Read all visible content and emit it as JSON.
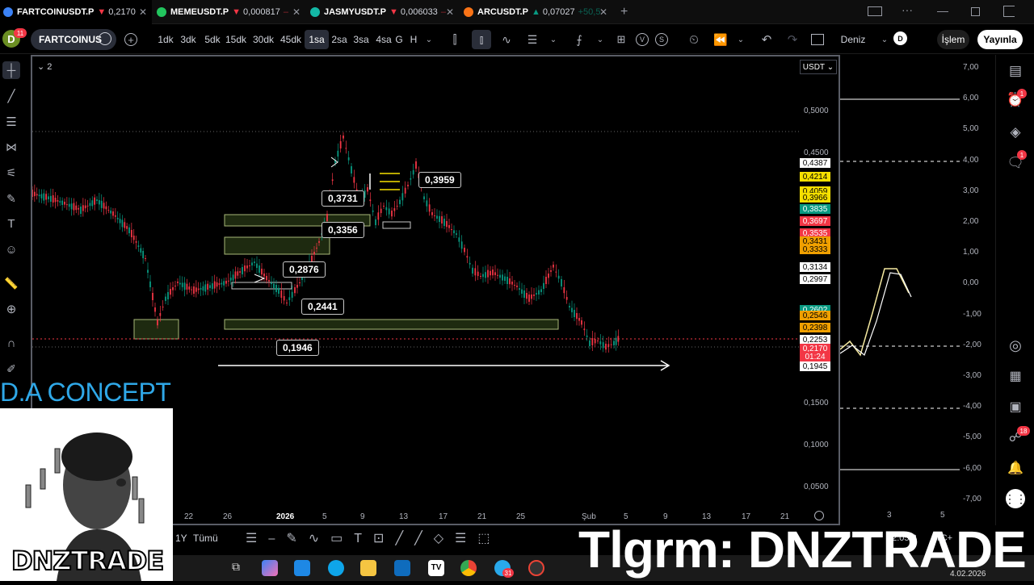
{
  "tabs": [
    {
      "symbol": "FARTCOINUSDT.P",
      "dir": "▼",
      "price": "0,2170",
      "change": "",
      "logo_color": "#3b82f6"
    },
    {
      "symbol": "MEMEUSDT.P",
      "dir": "▼",
      "price": "0,000817",
      "change": "–",
      "logo_color": "#22c55e"
    },
    {
      "symbol": "JASMYUSDT.P",
      "dir": "▼",
      "price": "0,006033",
      "change": "–",
      "logo_color": "#14b8a6"
    },
    {
      "symbol": "ARCUSDT.P",
      "dir": "▲",
      "price": "0,07027",
      "change": "+50,5",
      "logo_color": "#f97316"
    }
  ],
  "toolbar": {
    "avatar": "D",
    "avatar_badge": "11",
    "symbol": "FARTCOINUS",
    "intervals": [
      "1dk",
      "3dk",
      "5dk",
      "15dk",
      "30dk",
      "45dk",
      "1sa",
      "2sa",
      "3sa",
      "4sa",
      "G",
      "H"
    ],
    "active_interval": "1sa",
    "layout_name": "Deniz",
    "layout_badge": "D",
    "trade_label": "İşlem",
    "publish_label": "Yayınla",
    "alert_v": "V",
    "alert_s": "S"
  },
  "chart": {
    "legend_count": "2",
    "currency": "USDT",
    "price_ticks": [
      "0,5000",
      "0,4500",
      "0,1500",
      "0,1000",
      "0,0500"
    ],
    "price_labels": [
      {
        "value": "0,4387",
        "color": "#ffffff",
        "text_color": "#000"
      },
      {
        "value": "0,4214",
        "color": "#f5e000",
        "text_color": "#000"
      },
      {
        "value": "0,4059",
        "color": "#f5e000",
        "text_color": "#000"
      },
      {
        "value": "0,3966",
        "color": "#f5e000",
        "text_color": "#000"
      },
      {
        "value": "0,3835",
        "color": "#089981",
        "text_color": "#fff"
      },
      {
        "value": "0,3697",
        "color": "#f23645",
        "text_color": "#fff"
      },
      {
        "value": "0,3535",
        "color": "#f23645",
        "text_color": "#fff"
      },
      {
        "value": "0,3431",
        "color": "#f0a000",
        "text_color": "#000"
      },
      {
        "value": "0,3333",
        "color": "#f0a000",
        "text_color": "#000"
      },
      {
        "value": "0,3134",
        "color": "#ffffff",
        "text_color": "#000"
      },
      {
        "value": "0,2997",
        "color": "#ffffff",
        "text_color": "#000"
      },
      {
        "value": "0,2602",
        "color": "#089981",
        "text_color": "#fff"
      },
      {
        "value": "0,2546",
        "color": "#f0a000",
        "text_color": "#000"
      },
      {
        "value": "0,2398",
        "color": "#f0a000",
        "text_color": "#000"
      },
      {
        "value": "0,2253",
        "color": "#ffffff",
        "text_color": "#000"
      },
      {
        "value": "0,2170",
        "color": "#f23645",
        "text_color": "#fff"
      },
      {
        "value": "01:24",
        "color": "#f23645",
        "text_color": "#fff"
      },
      {
        "value": "0,1945",
        "color": "#ffffff",
        "text_color": "#000"
      }
    ],
    "time_ticks": [
      "22",
      "26",
      "2026",
      "5",
      "9",
      "13",
      "17",
      "21",
      "25",
      "Şub",
      "5",
      "9",
      "13",
      "17",
      "21"
    ],
    "callouts": [
      "0,3731",
      "0,3356",
      "0,3959",
      "0,2876",
      "0,2441",
      "0,1946"
    ]
  },
  "indicator_pane": {
    "ticks": [
      "7,00",
      "6,00",
      "5,00",
      "4,00",
      "3,00",
      "2,00",
      "1,00",
      "0,00",
      "-1,00",
      "-2,00",
      "-3,00",
      "-4,00",
      "-5,00",
      "-6,00",
      "-7,00"
    ],
    "time_ticks": [
      "3",
      "5"
    ]
  },
  "right_sidebar": {
    "badges": [
      "1",
      "1",
      "18"
    ]
  },
  "bottom": {
    "range_1y": "1Y",
    "range_all": "Tümü",
    "clock_partial": "02:05:3",
    "tz_partial": "TC+",
    "date": "4.02.2026"
  },
  "taskbar": {
    "chrome_badge": "31"
  },
  "overlay": {
    "concept": "D.A CONCEPT",
    "brand": "DNZTRADE",
    "brand_small": "DNZTRADE",
    "promo": "Tlgrm: DNZTRADE"
  }
}
